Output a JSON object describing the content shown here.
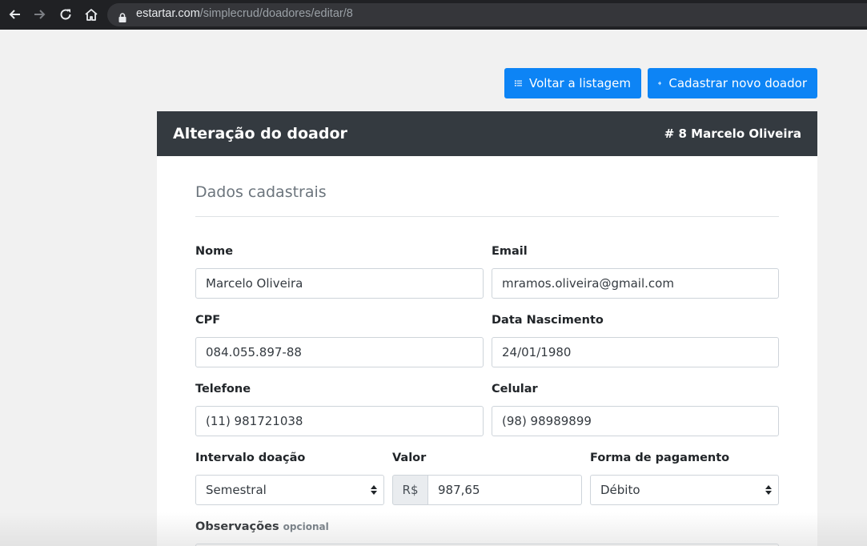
{
  "browser": {
    "url_host": "estartar.com",
    "url_path": "/simplecrud/doadores/editar/8"
  },
  "toolbar": {
    "back_label": "Voltar a listagem",
    "new_label": "Cadastrar novo doador",
    "accent": "#0d84f5"
  },
  "card": {
    "title": "Alteração do doador",
    "record_id": "# 8 Marcelo Oliveira",
    "header_color": "#343a40"
  },
  "form": {
    "section_title": "Dados cadastrais",
    "nome": {
      "label": "Nome",
      "value": "Marcelo Oliveira"
    },
    "email": {
      "label": "Email",
      "value": "mramos.oliveira@gmail.com"
    },
    "cpf": {
      "label": "CPF",
      "value": "084.055.897-88"
    },
    "nascimento": {
      "label": "Data Nascimento",
      "value": "24/01/1980"
    },
    "telefone": {
      "label": "Telefone",
      "value": "(11) 981721038"
    },
    "celular": {
      "label": "Celular",
      "value": "(98) 98989899"
    },
    "intervalo": {
      "label": "Intervalo doação",
      "value": "Semestral"
    },
    "valor": {
      "label": "Valor",
      "prefix": "R$",
      "value": "987,65"
    },
    "pagamento": {
      "label": "Forma de pagamento",
      "value": "Débito"
    },
    "observacoes": {
      "label": "Observações",
      "optional": "opcional"
    }
  }
}
